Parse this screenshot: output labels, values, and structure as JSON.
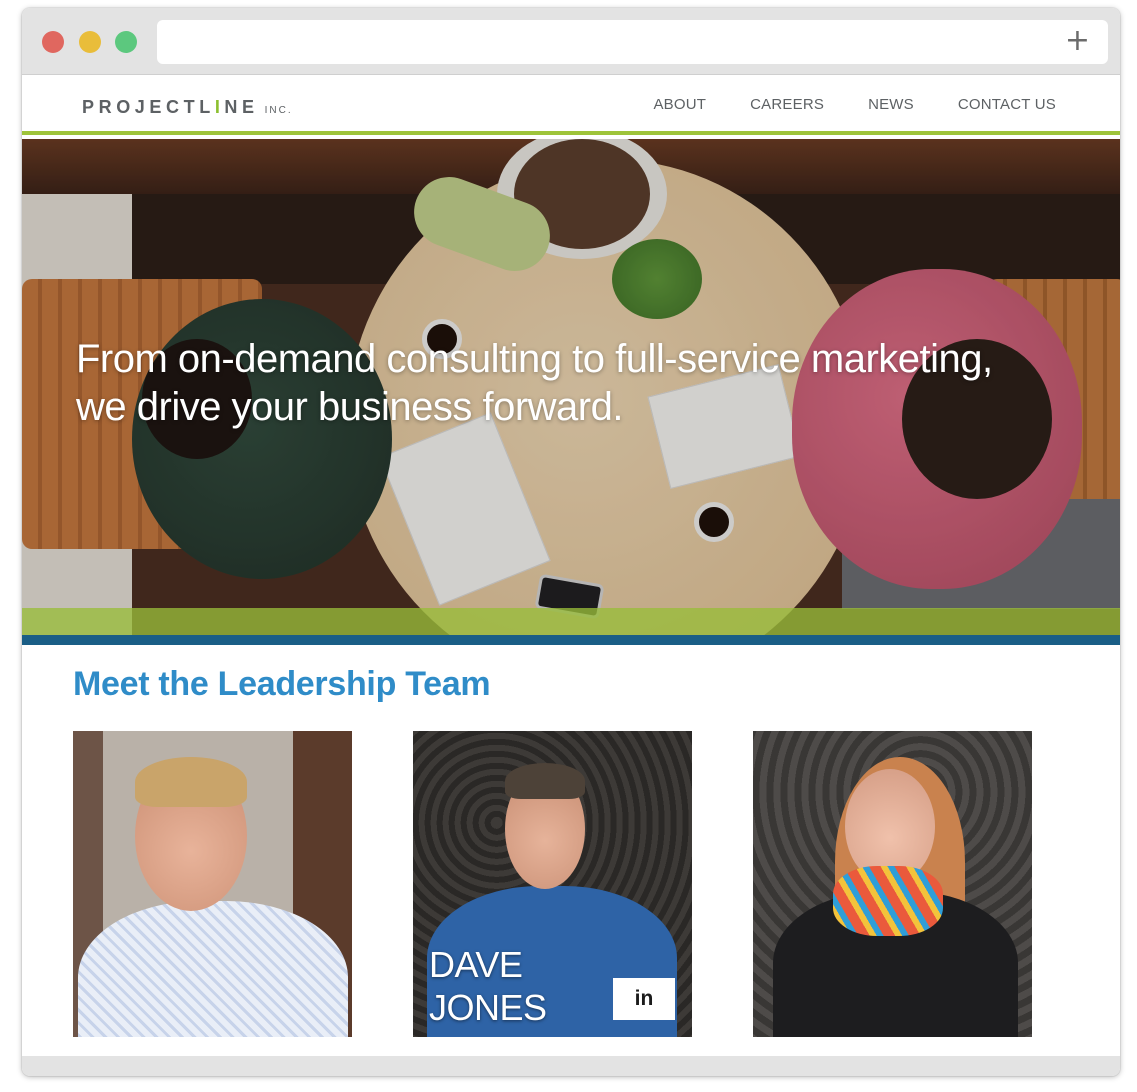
{
  "browser": {
    "new_tab_symbol": "+",
    "traffic_lights": {
      "close": "#e0675f",
      "minimize": "#e9bd3a",
      "maximize": "#5cc87e"
    }
  },
  "header": {
    "logo_left": "PROJECTL",
    "logo_accent": "I",
    "logo_right": "NE",
    "logo_suffix": "INC.",
    "nav": [
      {
        "label": "ABOUT"
      },
      {
        "label": "CAREERS"
      },
      {
        "label": "NEWS"
      },
      {
        "label": "CONTACT US"
      }
    ],
    "accent_color": "#9ec43a"
  },
  "hero": {
    "line1": "From on-demand consulting to full-service marketing,",
    "line2": "we drive your business forward."
  },
  "team": {
    "heading": "Meet the Leadership Team",
    "heading_color": "#2f8cc8",
    "members": [
      {
        "first_name": "",
        "last_name": ""
      },
      {
        "first_name": "DAVE",
        "last_name": "JONES",
        "social": "in"
      },
      {
        "first_name": "",
        "last_name": ""
      }
    ]
  }
}
